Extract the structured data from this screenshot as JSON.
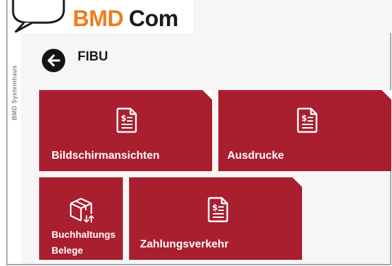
{
  "brand": {
    "name_part1": "BMD",
    "name_part2": "Com",
    "vendor": "BMD Systemhaus"
  },
  "page": {
    "title": "FIBU"
  },
  "colors": {
    "tile": "#a91f2f",
    "brand_orange": "#ee7d1e",
    "back_button": "#151515",
    "background": "#f6f6f6"
  },
  "tiles": [
    {
      "label": "Bildschirmansichten",
      "icon": "invoice-document-icon"
    },
    {
      "label": "Ausdrucke",
      "icon": "invoice-document-icon"
    },
    {
      "label_line1": "Buchhaltungs",
      "label_line2": "Belege",
      "icon": "package-box-icon"
    },
    {
      "label": "Zahlungsverkehr",
      "icon": "invoice-document-icon"
    }
  ]
}
